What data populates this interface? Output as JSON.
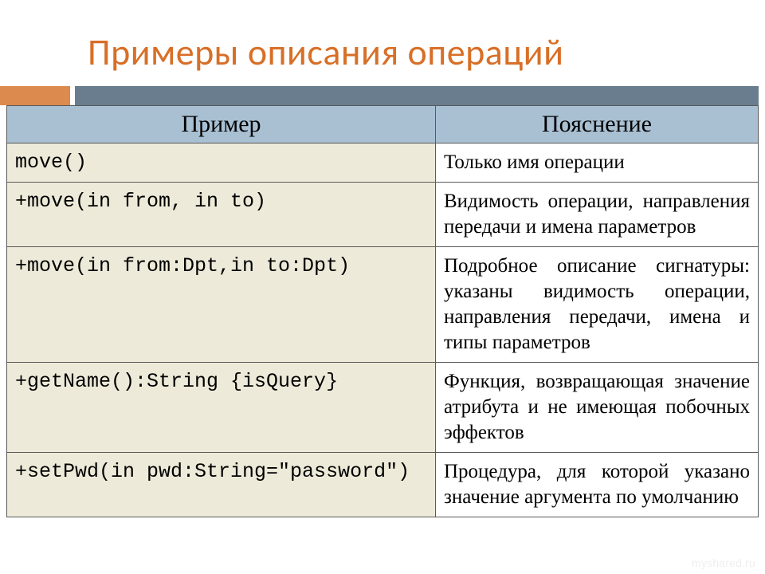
{
  "title": "Примеры описания операций",
  "headers": {
    "example": "Пример",
    "desc": "Пояснение"
  },
  "rows": [
    {
      "example": "move()",
      "desc": "Только имя операции"
    },
    {
      "example": "+move(in from, in to)",
      "desc": "Видимость операции, направления передачи и имена параметров"
    },
    {
      "example": "+move(in from:Dpt,in to:Dpt)",
      "desc": "Подробное описание сигнатуры: указаны видимость операции, направления передачи, имена и типы параметров"
    },
    {
      "example": "+getName():String {isQuery}",
      "desc": "Функция, возвращающая значение атрибута и не имеющая побочных эффектов"
    },
    {
      "example": "+setPwd(in pwd:String=\"password\")",
      "desc": "Процедура, для которой указано значение аргумента по умолчанию"
    }
  ],
  "watermark": "myshared.ru"
}
